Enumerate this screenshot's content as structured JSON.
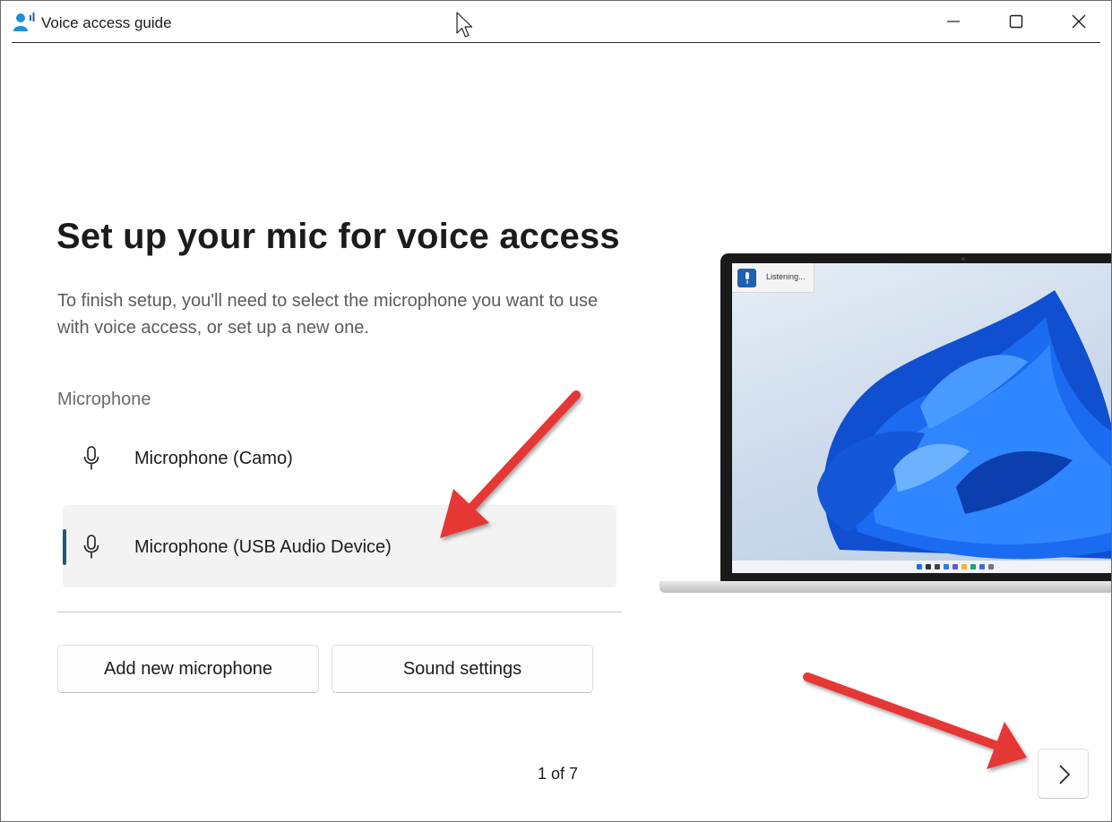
{
  "window": {
    "title": "Voice access guide",
    "controls": {
      "minimize": "minimize-icon",
      "maximize": "maximize-icon",
      "close": "close-icon"
    }
  },
  "page": {
    "heading": "Set up your mic for voice access",
    "description": "To finish setup, you'll need to select the microphone you want to use with voice access, or set up a new one.",
    "section_label": "Microphone",
    "microphones": [
      {
        "label": "Microphone (Camo)",
        "selected": false,
        "icon": "microphone-icon"
      },
      {
        "label": "Microphone (USB Audio Device)",
        "selected": true,
        "icon": "microphone-icon"
      }
    ],
    "buttons": {
      "add_new": "Add new microphone",
      "sound_settings": "Sound settings"
    },
    "pager": "1 of 7",
    "next_icon": "chevron-right-icon"
  },
  "illustration": {
    "voice_access_status": "Listening..."
  },
  "colors": {
    "accent": "#1e5a75",
    "arrow": "#e53935",
    "selected_bg": "#f3f3f3",
    "wallpaper_blue": "#1565e0"
  }
}
